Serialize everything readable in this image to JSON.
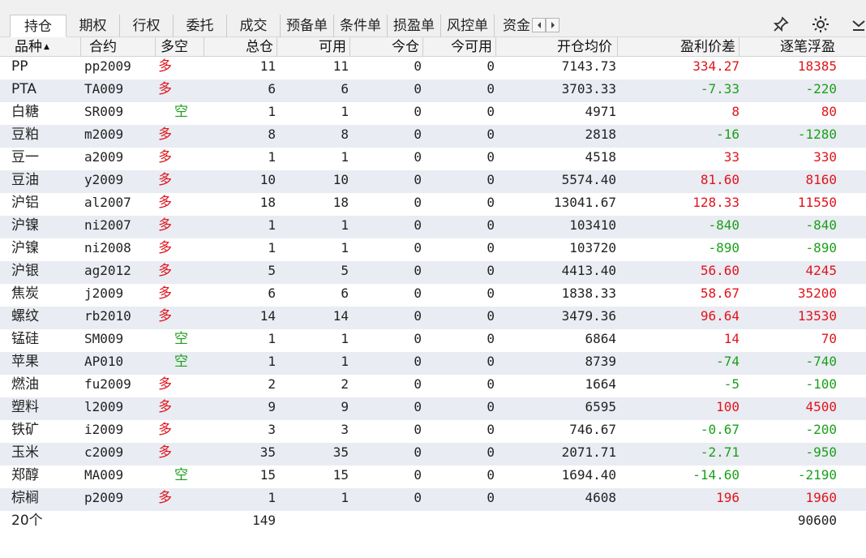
{
  "tabs": [
    {
      "label": "持仓",
      "active": true
    },
    {
      "label": "期权"
    },
    {
      "label": "行权"
    },
    {
      "label": "委托"
    },
    {
      "label": "成交"
    },
    {
      "label": "预备单"
    },
    {
      "label": "条件单"
    },
    {
      "label": "损盈单"
    },
    {
      "label": "风控单"
    },
    {
      "label": "资金"
    }
  ],
  "toolbar_icons": [
    "chevron-left-icon",
    "chevron-right-icon",
    "pin-icon",
    "gear-icon",
    "collapse-icon"
  ],
  "columns": {
    "name": "品种",
    "code": "合约",
    "direction": "多空",
    "total": "总仓",
    "available": "可用",
    "today": "今仓",
    "today_available": "今可用",
    "avg_price": "开仓均价",
    "price_diff": "盈利价差",
    "float_pnl": "逐笔浮盈"
  },
  "sort_indicator": "▲",
  "colors": {
    "long": "#e0141c",
    "short": "#1aa01a",
    "profit": "#e0141c",
    "loss": "#1aa01a"
  },
  "rows": [
    {
      "name": "PP",
      "code": "pp2009",
      "dir": "多",
      "total": "11",
      "avail": "11",
      "today": "0",
      "tavail": "0",
      "avg": "7143.73",
      "diff": "334.27",
      "pnl": "18385"
    },
    {
      "name": "PTA",
      "code": "TA009",
      "dir": "多",
      "total": "6",
      "avail": "6",
      "today": "0",
      "tavail": "0",
      "avg": "3703.33",
      "diff": "-7.33",
      "pnl": "-220"
    },
    {
      "name": "白糖",
      "code": "SR009",
      "dir": "空",
      "total": "1",
      "avail": "1",
      "today": "0",
      "tavail": "0",
      "avg": "4971",
      "diff": "8",
      "pnl": "80"
    },
    {
      "name": "豆粕",
      "code": "m2009",
      "dir": "多",
      "total": "8",
      "avail": "8",
      "today": "0",
      "tavail": "0",
      "avg": "2818",
      "diff": "-16",
      "pnl": "-1280"
    },
    {
      "name": "豆一",
      "code": "a2009",
      "dir": "多",
      "total": "1",
      "avail": "1",
      "today": "0",
      "tavail": "0",
      "avg": "4518",
      "diff": "33",
      "pnl": "330"
    },
    {
      "name": "豆油",
      "code": "y2009",
      "dir": "多",
      "total": "10",
      "avail": "10",
      "today": "0",
      "tavail": "0",
      "avg": "5574.40",
      "diff": "81.60",
      "pnl": "8160"
    },
    {
      "name": "沪铝",
      "code": "al2007",
      "dir": "多",
      "total": "18",
      "avail": "18",
      "today": "0",
      "tavail": "0",
      "avg": "13041.67",
      "diff": "128.33",
      "pnl": "11550"
    },
    {
      "name": "沪镍",
      "code": "ni2007",
      "dir": "多",
      "total": "1",
      "avail": "1",
      "today": "0",
      "tavail": "0",
      "avg": "103410",
      "diff": "-840",
      "pnl": "-840"
    },
    {
      "name": "沪镍",
      "code": "ni2008",
      "dir": "多",
      "total": "1",
      "avail": "1",
      "today": "0",
      "tavail": "0",
      "avg": "103720",
      "diff": "-890",
      "pnl": "-890"
    },
    {
      "name": "沪银",
      "code": "ag2012",
      "dir": "多",
      "total": "5",
      "avail": "5",
      "today": "0",
      "tavail": "0",
      "avg": "4413.40",
      "diff": "56.60",
      "pnl": "4245"
    },
    {
      "name": "焦炭",
      "code": "j2009",
      "dir": "多",
      "total": "6",
      "avail": "6",
      "today": "0",
      "tavail": "0",
      "avg": "1838.33",
      "diff": "58.67",
      "pnl": "35200"
    },
    {
      "name": "螺纹",
      "code": "rb2010",
      "dir": "多",
      "total": "14",
      "avail": "14",
      "today": "0",
      "tavail": "0",
      "avg": "3479.36",
      "diff": "96.64",
      "pnl": "13530"
    },
    {
      "name": "锰硅",
      "code": "SM009",
      "dir": "空",
      "total": "1",
      "avail": "1",
      "today": "0",
      "tavail": "0",
      "avg": "6864",
      "diff": "14",
      "pnl": "70"
    },
    {
      "name": "苹果",
      "code": "AP010",
      "dir": "空",
      "total": "1",
      "avail": "1",
      "today": "0",
      "tavail": "0",
      "avg": "8739",
      "diff": "-74",
      "pnl": "-740"
    },
    {
      "name": "燃油",
      "code": "fu2009",
      "dir": "多",
      "total": "2",
      "avail": "2",
      "today": "0",
      "tavail": "0",
      "avg": "1664",
      "diff": "-5",
      "pnl": "-100"
    },
    {
      "name": "塑料",
      "code": "l2009",
      "dir": "多",
      "total": "9",
      "avail": "9",
      "today": "0",
      "tavail": "0",
      "avg": "6595",
      "diff": "100",
      "pnl": "4500"
    },
    {
      "name": "铁矿",
      "code": "i2009",
      "dir": "多",
      "total": "3",
      "avail": "3",
      "today": "0",
      "tavail": "0",
      "avg": "746.67",
      "diff": "-0.67",
      "pnl": "-200"
    },
    {
      "name": "玉米",
      "code": "c2009",
      "dir": "多",
      "total": "35",
      "avail": "35",
      "today": "0",
      "tavail": "0",
      "avg": "2071.71",
      "diff": "-2.71",
      "pnl": "-950"
    },
    {
      "name": "郑醇",
      "code": "MA009",
      "dir": "空",
      "total": "15",
      "avail": "15",
      "today": "0",
      "tavail": "0",
      "avg": "1694.40",
      "diff": "-14.60",
      "pnl": "-2190"
    },
    {
      "name": "棕榈",
      "code": "p2009",
      "dir": "多",
      "total": "1",
      "avail": "1",
      "today": "0",
      "tavail": "0",
      "avg": "4608",
      "diff": "196",
      "pnl": "1960"
    }
  ],
  "summary": {
    "count": "20个",
    "total": "149",
    "pnl": "90600"
  }
}
